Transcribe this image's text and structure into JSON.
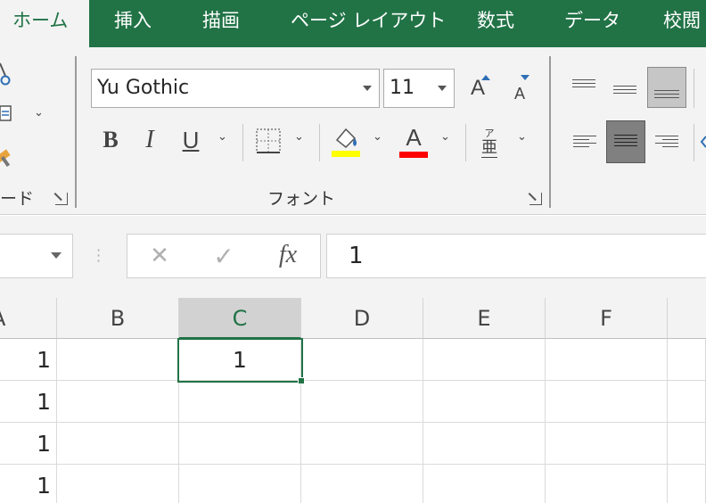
{
  "tabs": [
    {
      "label": "ホーム",
      "active": true
    },
    {
      "label": "挿入"
    },
    {
      "label": "描画"
    },
    {
      "label": "ページ レイアウト"
    },
    {
      "label": "数式"
    },
    {
      "label": "データ"
    },
    {
      "label": "校閲"
    }
  ],
  "ribbon": {
    "clipboard_label_fragment": "ード",
    "font_group_label": "フォント",
    "font_name": "Yu Gothic",
    "font_size": "11",
    "grow_font_glyph": "A",
    "shrink_font_glyph": "A",
    "bold_glyph": "B",
    "italic_glyph": "I",
    "underline_glyph": "U",
    "font_color_glyph": "A",
    "phonetic_top": "ア",
    "phonetic_bottom": "亜",
    "fill_color": "#ffff00",
    "font_color": "#ff0000",
    "accent": "#217346"
  },
  "formula_bar": {
    "cancel_glyph": "✕",
    "enter_glyph": "✓",
    "fx_label": "fx",
    "value": "1"
  },
  "grid": {
    "column_headers": [
      "A",
      "B",
      "C",
      "D",
      "E",
      "F"
    ],
    "selected_column": "C",
    "rows": [
      [
        "1",
        "",
        "1",
        "",
        "",
        "",
        ""
      ],
      [
        "1",
        "",
        "",
        "",
        "",
        "",
        ""
      ],
      [
        "1",
        "",
        "",
        "",
        "",
        "",
        ""
      ],
      [
        "1",
        "",
        "",
        "",
        "",
        "",
        ""
      ]
    ]
  }
}
